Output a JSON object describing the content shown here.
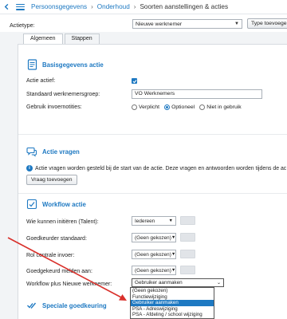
{
  "header": {
    "breadcrumbs": [
      "Persoonsgegevens",
      "Onderhoud",
      "Soorten aanstellingen & acties"
    ]
  },
  "type_bar": {
    "label": "Actietype:",
    "selected": "Nieuwe werknemer",
    "button_label": "Type toevoegen"
  },
  "tabs": [
    {
      "label": "Algemeen",
      "active": true
    },
    {
      "label": "Stappen",
      "active": false
    }
  ],
  "basis": {
    "title": "Basisgegevens actie",
    "active_label": "Actie actief:",
    "active_checked": true,
    "group_label": "Standaard werknemersgroep:",
    "group_value": "VO Werknemers",
    "notes_label": "Gebruik invoernotities:",
    "notes_options": [
      "Verplicht",
      "Optioneel",
      "Niet in gebruik"
    ],
    "notes_selected": "Optioneel"
  },
  "vragen": {
    "title": "Actie vragen",
    "info": "Actie vragen worden gesteld bij de start van de actie. Deze vragen en antwoorden worden tijdens de ac",
    "button_label": "Vraag toevoegen"
  },
  "workflow": {
    "title": "Workflow actie",
    "rows": [
      {
        "label": "Wie kunnen initiëren (Talent):",
        "value": "Iedereen"
      },
      {
        "label": "Goedkeurder standaard:",
        "value": "(Geen gekozen)"
      },
      {
        "label": "Rol centrale invoer:",
        "value": "(Geen gekozen)"
      },
      {
        "label": "Goedgekeurd melden aan:",
        "value": "(Geen gekozen)"
      }
    ],
    "plus_label": "Workflow plus Nieuwe werknemer:",
    "plus_value": "Gebruiker aanmaken",
    "dropdown_options": [
      "(Geen gekozen)",
      "Functiewijziging",
      "Gebruiker aanmaken",
      "PSA - Adreswijziging",
      "PSA - Afdeling / school wijziging"
    ],
    "dropdown_selected": "Gebruiker aanmaken"
  },
  "speciale": {
    "title": "Speciale goedkeuring"
  },
  "colors": {
    "accent": "#1e79c2",
    "arrow": "#d9302b"
  }
}
